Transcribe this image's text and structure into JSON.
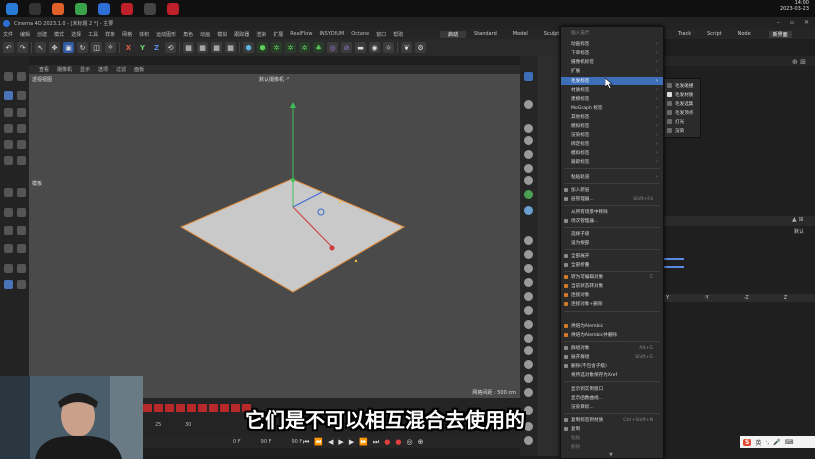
{
  "os": {
    "time": "14:00",
    "date": "2023-03-23"
  },
  "window": {
    "title": "Cinema 4D 2023.1.0 - [未标题 2 *] - 主要"
  },
  "menubar": {
    "items": [
      "文件",
      "编辑",
      "创建",
      "模式",
      "选择",
      "工具",
      "样条",
      "网格",
      "体积",
      "运动图形",
      "角色",
      "动画",
      "模拟",
      "跟踪器",
      "渲染",
      "扩展",
      "RealFlow",
      "INSYDIUM",
      "Octane",
      "窗口",
      "帮助"
    ],
    "layouts": [
      "启动",
      "Standard",
      "Model",
      "Sculpt"
    ],
    "right_layouts": [
      "Track",
      "Script",
      "Node"
    ],
    "new_layout": "新界面"
  },
  "toolbar": {
    "axis_x": "X",
    "axis_y": "Y",
    "axis_z": "Z"
  },
  "viewport": {
    "menu": [
      "查看",
      "摄像机",
      "显示",
      "选项",
      "过滤",
      "面板"
    ],
    "label": "透视视图",
    "camera": "默认摄像机 ·⁰",
    "grid": "网格间距 : 500 cm",
    "left_tag": "模板"
  },
  "context_menu": {
    "header": "插入迭代",
    "items": [
      {
        "label": "动画标签",
        "submenu": true
      },
      {
        "label": "下单标签",
        "submenu": true
      },
      {
        "label": "摄像机标签",
        "submenu": true
      },
      {
        "label": "扩展",
        "submenu": true
      },
      {
        "label": "毛发标签",
        "submenu": true,
        "highlighted": true
      },
      {
        "label": "材质标签",
        "submenu": true
      },
      {
        "label": "建模标签",
        "submenu": true
      },
      {
        "label": "MoGraph 标签",
        "submenu": true
      },
      {
        "label": "其他标签",
        "submenu": true
      },
      {
        "label": "模拟标签",
        "submenu": true
      },
      {
        "label": "渲染标签",
        "submenu": true
      },
      {
        "label": "绑定标签",
        "submenu": true
      },
      {
        "label": "模拟标签",
        "submenu": true
      },
      {
        "label": "跟踪标签",
        "submenu": true
      },
      {
        "label": "粘贴轨道",
        "submenu": true
      },
      {
        "label": "加入新层"
      },
      {
        "label": "层管理器...",
        "shortcut": "Shift+F4"
      },
      {
        "label": "从所有场景中移除"
      },
      {
        "label": "场次管理器..."
      },
      {
        "label": "选择子级"
      },
      {
        "label": "设为根部"
      },
      {
        "label": "全部展开"
      },
      {
        "label": "全部折叠"
      },
      {
        "label": "转为可编辑对象",
        "shortcut": "C"
      },
      {
        "label": "当前状态转对象"
      },
      {
        "label": "连接对象"
      },
      {
        "label": "连接对象+删除"
      },
      {
        "label": "烘焙为Alembic"
      },
      {
        "label": "烘焙为Alembic并删除"
      },
      {
        "label": "群组对象",
        "shortcut": "Alt+G"
      },
      {
        "label": "展开群组",
        "shortcut": "Shift+G"
      },
      {
        "label": "删除(不包含子级)"
      },
      {
        "label": "将所选对象保存为Xref"
      },
      {
        "label": "显示到实例窗口"
      },
      {
        "label": "显示函数曲线..."
      },
      {
        "label": "渲染目标..."
      },
      {
        "label": "复制标签到材质",
        "shortcut": "Ctrl+Shift+N"
      },
      {
        "label": "复制"
      },
      {
        "label": "粘贴"
      },
      {
        "label": "删除"
      }
    ]
  },
  "submenu": {
    "items": [
      "毛发碰撞",
      "毛发材质",
      "毛发选集",
      "毛发顶点",
      "灯光",
      "渲染"
    ]
  },
  "attributes": {
    "mode_label": "默认",
    "coords": [
      "Y",
      "·Y",
      "·Z",
      "Z"
    ]
  },
  "timeline": {
    "frame_start": "0 F",
    "frame_end": "90 F",
    "frame_end2": "90 F",
    "ticks": [
      "25",
      "30"
    ]
  },
  "subtitle": {
    "text": "它们是不可以相互混合去使用的"
  },
  "ime": {
    "logo": "S",
    "lang": "英"
  }
}
